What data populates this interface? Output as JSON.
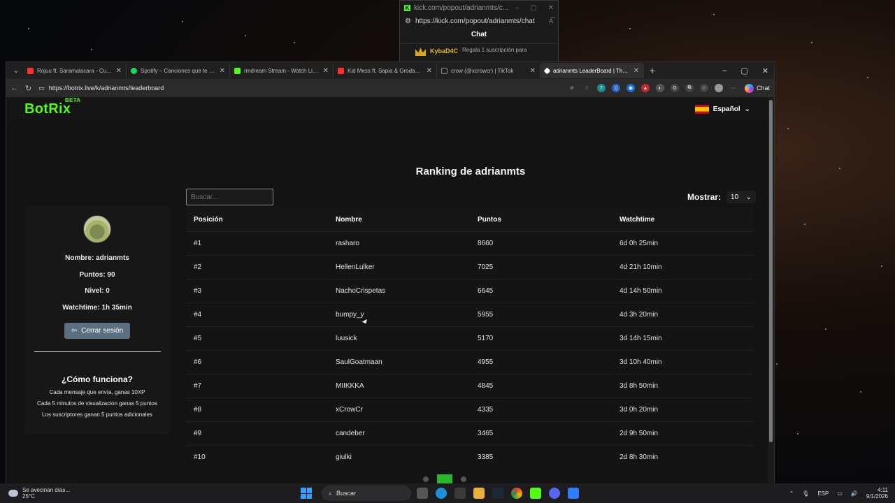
{
  "popout": {
    "title": "kick.com/popout/adrianmts/c...",
    "url": "https://kick.com/popout/adrianmts/chat",
    "chat_title": "Chat",
    "message_user": "KybaD4C",
    "message_text": "Regala 1 suscripción para"
  },
  "browser": {
    "tabs": [
      {
        "label": "Rojuu ft. Saramalacara - Cuando",
        "color": "#ff2f2f"
      },
      {
        "label": "Spotify – Canciones que te gustan",
        "color": "#1ed760"
      },
      {
        "label": "rmdream Stream - Watch Live on",
        "color": "#53fc18"
      },
      {
        "label": "Kid Mess ft. Sapia & Grodayz - Se",
        "color": "#ff2f2f"
      },
      {
        "label": "crow (@xcrowcr) | TikTok",
        "color": "#222222"
      },
      {
        "label": "adrianmts LeaderBoard | The best",
        "color": "#ffffff"
      }
    ],
    "url": "https://botrix.live/k/adrianmts/leaderboard",
    "copilot_label": "Chat"
  },
  "site": {
    "logo": "BotRix",
    "beta": "BETA",
    "language": "Español",
    "accent": "#53fc18"
  },
  "leaderboard": {
    "title": "Ranking de adrianmts",
    "search_placeholder": "Buscar...",
    "show_label": "Mostrar:",
    "show_value": "10",
    "columns": [
      "Posición",
      "Nombre",
      "Puntos",
      "Watchtime"
    ],
    "rows": [
      {
        "pos": "#1",
        "name": "rasharo",
        "points": "8660",
        "watchtime": "6d 0h 25min"
      },
      {
        "pos": "#2",
        "name": "HellenLulker",
        "points": "7025",
        "watchtime": "4d 21h 10min"
      },
      {
        "pos": "#3",
        "name": "NachoCrispetas",
        "points": "6645",
        "watchtime": "4d 14h 50min"
      },
      {
        "pos": "#4",
        "name": "bumpy_y",
        "points": "5955",
        "watchtime": "4d 3h 20min"
      },
      {
        "pos": "#5",
        "name": "luusick",
        "points": "5170",
        "watchtime": "3d 14h 15min"
      },
      {
        "pos": "#6",
        "name": "SaulGoatmaan",
        "points": "4955",
        "watchtime": "3d 10h 40min"
      },
      {
        "pos": "#7",
        "name": "MIIKKKA",
        "points": "4845",
        "watchtime": "3d 8h 50min"
      },
      {
        "pos": "#8",
        "name": "xCrowCr",
        "points": "4335",
        "watchtime": "3d 0h 20min"
      },
      {
        "pos": "#9",
        "name": "candeber",
        "points": "3465",
        "watchtime": "2d 9h 50min"
      },
      {
        "pos": "#10",
        "name": "giulki",
        "points": "3385",
        "watchtime": "2d 8h 30min"
      }
    ]
  },
  "profile": {
    "name": "Nombre: adrianmts",
    "points": "Puntos: 90",
    "level": "Nivel: 0",
    "watchtime": "Watchtime: 1h 35min",
    "logout": "Cerrar sesión",
    "how_title": "¿Cómo funciona?",
    "rules": [
      "Cada mensaje que envía, ganas 10XP",
      "Cada 5 minutos de visualizacion ganas 5 puntos",
      "Los suscriptores ganan 5 puntos adicionales"
    ]
  },
  "taskbar": {
    "weather_line1": "Se avecinan días...",
    "weather_line2": "25°C",
    "search": "Buscar",
    "lang": "ESP",
    "time": "4:11",
    "date": "9/1/2026"
  }
}
